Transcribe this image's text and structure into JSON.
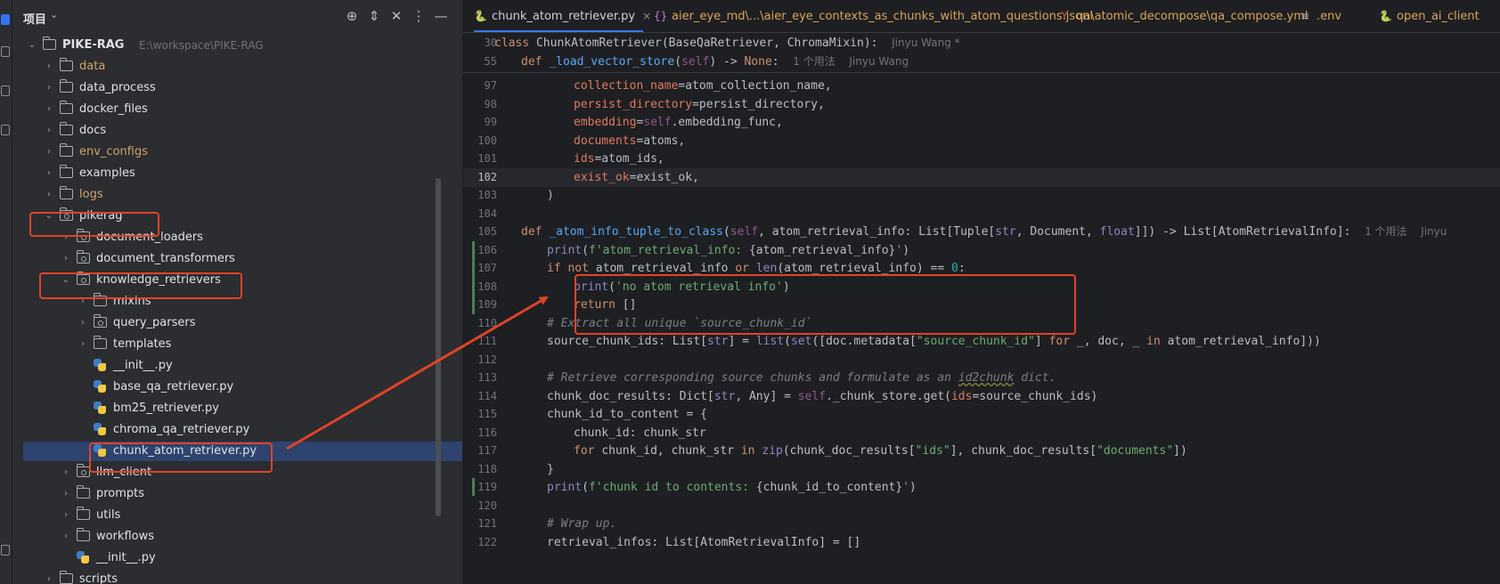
{
  "project_panel": {
    "title": "项目",
    "tree": [
      {
        "label": "PIKE-RAG",
        "path": "E:\\workspace\\PIKE-RAG",
        "kind": "root",
        "expanded": true
      },
      {
        "label": "data",
        "kind": "folder",
        "excluded": true
      },
      {
        "label": "data_process",
        "kind": "folder"
      },
      {
        "label": "docker_files",
        "kind": "folder"
      },
      {
        "label": "docs",
        "kind": "folder"
      },
      {
        "label": "env_configs",
        "kind": "folder",
        "excluded": true
      },
      {
        "label": "examples",
        "kind": "folder"
      },
      {
        "label": "logs",
        "kind": "folder",
        "excluded": true
      },
      {
        "label": "pikerag",
        "kind": "package",
        "expanded": true
      },
      {
        "label": "document_loaders",
        "kind": "package"
      },
      {
        "label": "document_transformers",
        "kind": "package"
      },
      {
        "label": "knowledge_retrievers",
        "kind": "package",
        "expanded": true
      },
      {
        "label": "mixins",
        "kind": "folder"
      },
      {
        "label": "query_parsers",
        "kind": "package"
      },
      {
        "label": "templates",
        "kind": "folder"
      },
      {
        "label": "__init__.py",
        "kind": "py"
      },
      {
        "label": "base_qa_retriever.py",
        "kind": "py"
      },
      {
        "label": "bm25_retriever.py",
        "kind": "py"
      },
      {
        "label": "chroma_qa_retriever.py",
        "kind": "py"
      },
      {
        "label": "chunk_atom_retriever.py",
        "kind": "py",
        "selected": true
      },
      {
        "label": "llm_client",
        "kind": "package"
      },
      {
        "label": "prompts",
        "kind": "folder"
      },
      {
        "label": "utils",
        "kind": "folder"
      },
      {
        "label": "workflows",
        "kind": "folder"
      },
      {
        "label": "__init__.py",
        "kind": "py"
      },
      {
        "label": "scripts",
        "kind": "folder"
      }
    ]
  },
  "tabs": [
    {
      "label": "chunk_atom_retriever.py",
      "icon": "python-icon",
      "active": true
    },
    {
      "label": "aier_eye_md\\...\\aier_eye_contexts_as_chunks_with_atom_questions.jsonl",
      "icon": "json-icon",
      "modified": true
    },
    {
      "label": "qa\\atomic_decompose\\qa_compose.yml",
      "icon": "yaml-icon",
      "modified": true
    },
    {
      "label": ".env",
      "icon": "env-icon",
      "modified": true
    },
    {
      "label": "open_ai_client",
      "icon": "python-icon",
      "modified": true
    }
  ],
  "sticky": {
    "line1_no": "30",
    "line1_code": "class ChunkAtomRetriever(BaseQaRetriever, ChromaMixin):",
    "line1_hint": "Jinyu Wang *",
    "line2_no": "55",
    "line2_code": "def _load_vector_store(self) -> None:",
    "line2_usage": "1 个用法",
    "line2_hint": "Jinyu Wang"
  },
  "code": {
    "method_usage": "1 个用法",
    "method_author": "Jinyu",
    "line_numbers": [
      "97",
      "98",
      "99",
      "100",
      "101",
      "102",
      "103",
      "104",
      "105",
      "106",
      "107",
      "108",
      "109",
      "110",
      "111",
      "112",
      "113",
      "114",
      "115",
      "116",
      "117",
      "118",
      "119",
      "120",
      "121",
      "122"
    ]
  }
}
